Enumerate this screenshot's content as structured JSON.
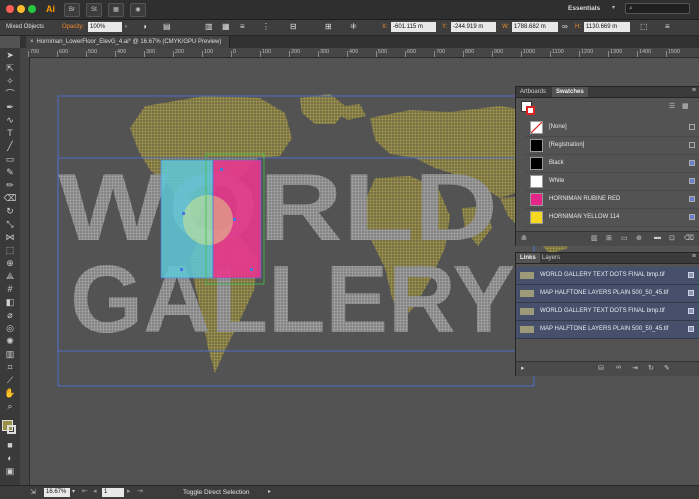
{
  "app": {
    "logo": "Ai",
    "workspace": "Essentials",
    "buttons": [
      "Br",
      "St"
    ]
  },
  "control_bar": {
    "selection": "Mixed Objects",
    "opacity_label": "Opacity:",
    "opacity_value": "100%",
    "x_label": "X:",
    "x_value": "-601.115 m",
    "y_label": "Y:",
    "y_value": "-244.919 m",
    "w_label": "W:",
    "w_value": "1788.682 m",
    "h_label": "H:",
    "h_value": "1130.669 m"
  },
  "document_tab": {
    "close": "×",
    "title": "Horniman_LowerFloor_ElevG_4.ai* @ 16.67% (CMYK/GPU Preview)"
  },
  "ruler": {
    "h_ticks": [
      "700",
      "600",
      "500",
      "400",
      "300",
      "200",
      "100",
      "0",
      "100",
      "200",
      "300",
      "400",
      "500",
      "600",
      "700",
      "800",
      "900",
      "1000",
      "1100",
      "1200",
      "1300",
      "1400",
      "1500"
    ]
  },
  "artwork": {
    "line1": "WORLD",
    "line2": "GALLERY",
    "map_color": "#9b9146",
    "text_color": "#8f8f8f",
    "cyan": "#5ec8d8",
    "magenta": "#e8378d"
  },
  "swatches_panel": {
    "tabs": [
      "Artboards",
      "Swatches"
    ],
    "items": [
      {
        "name": "[None]",
        "color": "none"
      },
      {
        "name": "[Registration]",
        "color": "#000000"
      },
      {
        "name": "Black",
        "color": "#000000"
      },
      {
        "name": "White",
        "color": "#ffffff"
      },
      {
        "name": "HORNIMAN RUBINE RED",
        "color": "#e3268a"
      },
      {
        "name": "HORNIMAN YELLOW 114",
        "color": "#f5d920"
      }
    ]
  },
  "links_panel": {
    "tabs": [
      "Links",
      "Layers"
    ],
    "items": [
      {
        "name": "WORLD GALLERY TEXT DOTS FINAL bmp.tif"
      },
      {
        "name": "MAP HALFTONE LAYERS PLAIN 500_50_45.tif"
      },
      {
        "name": "WORLD GALLERY TEXT DOTS FINAL bmp.tif"
      },
      {
        "name": "MAP HALFTONE LAYERS PLAIN 500_50_45.tif"
      }
    ]
  },
  "status_bar": {
    "zoom": "16.67%",
    "artboard": "1",
    "tool_status": "Toggle Direct Selection"
  }
}
